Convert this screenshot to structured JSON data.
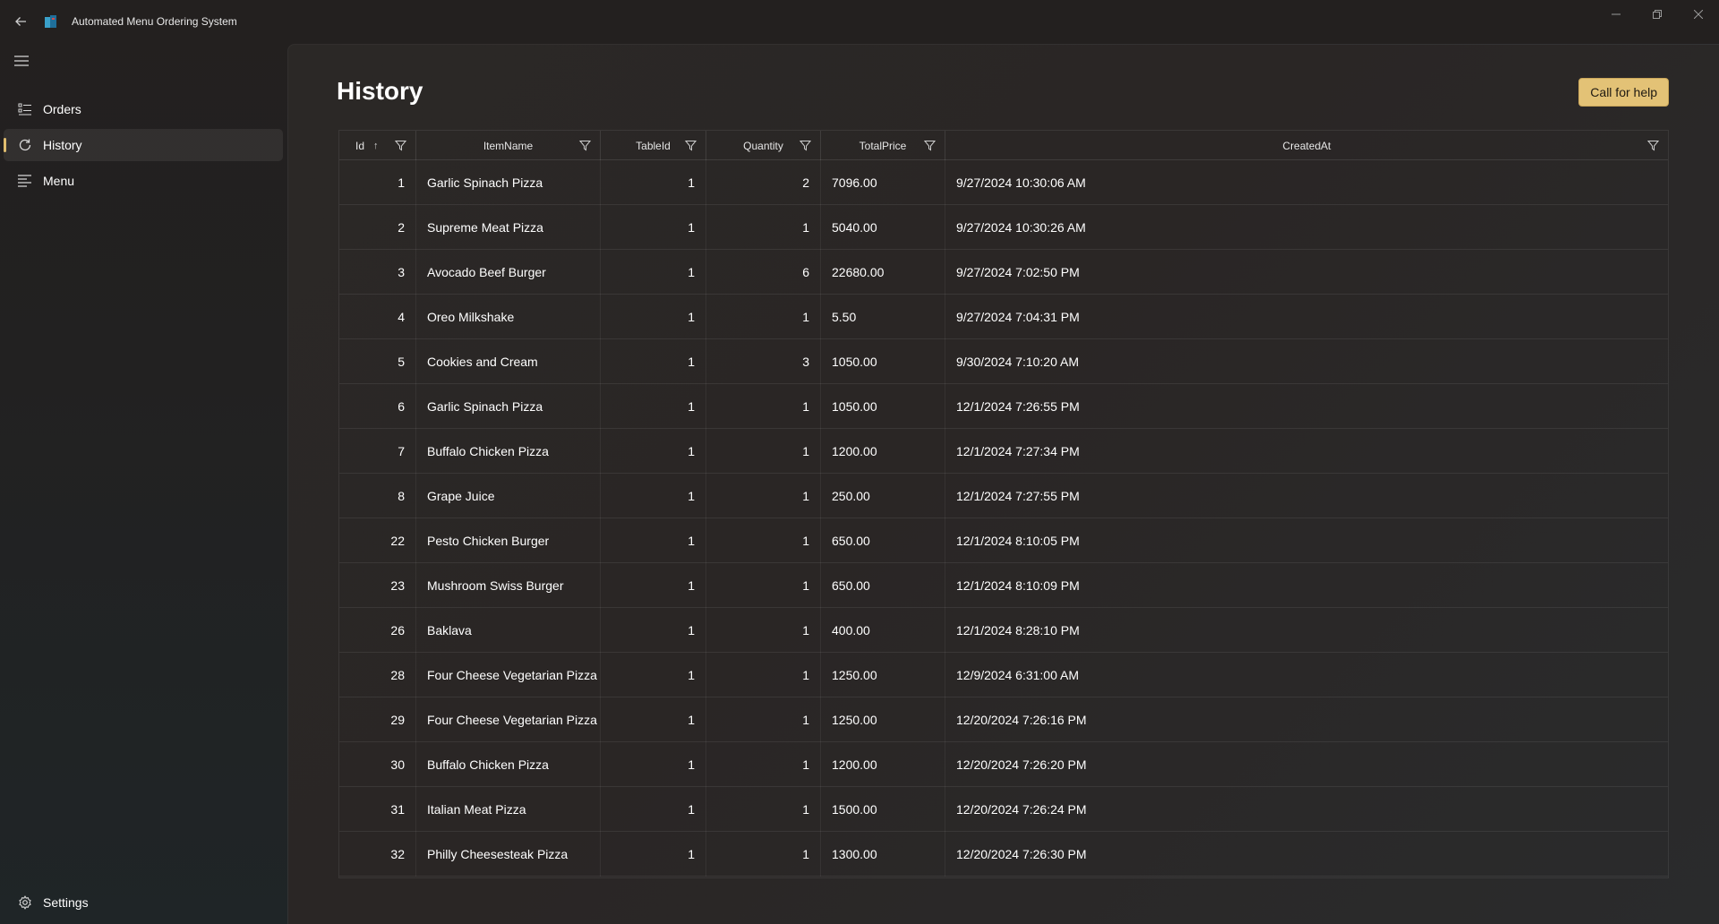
{
  "window": {
    "title": "Automated Menu Ordering System"
  },
  "sidebar": {
    "items": [
      {
        "label": "Orders",
        "icon": "list-icon"
      },
      {
        "label": "History",
        "icon": "refresh-icon",
        "selected": true
      },
      {
        "label": "Menu",
        "icon": "menu-lines-icon"
      }
    ],
    "settings_label": "Settings"
  },
  "page": {
    "title": "History",
    "help_button": "Call for help"
  },
  "table": {
    "columns": [
      "Id",
      "ItemName",
      "TableId",
      "Quantity",
      "TotalPrice",
      "CreatedAt"
    ],
    "sort": {
      "column": "Id",
      "direction": "ascending"
    },
    "rows": [
      {
        "id": "1",
        "item": "Garlic Spinach Pizza",
        "table": "1",
        "qty": "2",
        "price": "7096.00",
        "created": "9/27/2024 10:30:06 AM"
      },
      {
        "id": "2",
        "item": "Supreme Meat Pizza",
        "table": "1",
        "qty": "1",
        "price": "5040.00",
        "created": "9/27/2024 10:30:26 AM"
      },
      {
        "id": "3",
        "item": "Avocado Beef Burger",
        "table": "1",
        "qty": "6",
        "price": "22680.00",
        "created": "9/27/2024 7:02:50 PM"
      },
      {
        "id": "4",
        "item": "Oreo Milkshake",
        "table": "1",
        "qty": "1",
        "price": "5.50",
        "created": "9/27/2024 7:04:31 PM"
      },
      {
        "id": "5",
        "item": "Cookies and Cream",
        "table": "1",
        "qty": "3",
        "price": "1050.00",
        "created": "9/30/2024 7:10:20 AM"
      },
      {
        "id": "6",
        "item": "Garlic Spinach Pizza",
        "table": "1",
        "qty": "1",
        "price": "1050.00",
        "created": "12/1/2024 7:26:55 PM"
      },
      {
        "id": "7",
        "item": "Buffalo Chicken Pizza",
        "table": "1",
        "qty": "1",
        "price": "1200.00",
        "created": "12/1/2024 7:27:34 PM"
      },
      {
        "id": "8",
        "item": "Grape Juice",
        "table": "1",
        "qty": "1",
        "price": "250.00",
        "created": "12/1/2024 7:27:55 PM"
      },
      {
        "id": "22",
        "item": "Pesto Chicken Burger",
        "table": "1",
        "qty": "1",
        "price": "650.00",
        "created": "12/1/2024 8:10:05 PM"
      },
      {
        "id": "23",
        "item": "Mushroom Swiss Burger",
        "table": "1",
        "qty": "1",
        "price": "650.00",
        "created": "12/1/2024 8:10:09 PM"
      },
      {
        "id": "26",
        "item": "Baklava",
        "table": "1",
        "qty": "1",
        "price": "400.00",
        "created": "12/1/2024 8:28:10 PM"
      },
      {
        "id": "28",
        "item": "Four Cheese Vegetarian Pizza",
        "table": "1",
        "qty": "1",
        "price": "1250.00",
        "created": "12/9/2024 6:31:00 AM"
      },
      {
        "id": "29",
        "item": "Four Cheese Vegetarian Pizza",
        "table": "1",
        "qty": "1",
        "price": "1250.00",
        "created": "12/20/2024 7:26:16 PM"
      },
      {
        "id": "30",
        "item": "Buffalo Chicken Pizza",
        "table": "1",
        "qty": "1",
        "price": "1200.00",
        "created": "12/20/2024 7:26:20 PM"
      },
      {
        "id": "31",
        "item": "Italian Meat Pizza",
        "table": "1",
        "qty": "1",
        "price": "1500.00",
        "created": "12/20/2024 7:26:24 PM"
      },
      {
        "id": "32",
        "item": "Philly Cheesesteak Pizza",
        "table": "1",
        "qty": "1",
        "price": "1300.00",
        "created": "12/20/2024 7:26:30 PM"
      }
    ]
  },
  "colors": {
    "accent": "#e3c276",
    "selection_indicator": "#e0bd6e"
  }
}
